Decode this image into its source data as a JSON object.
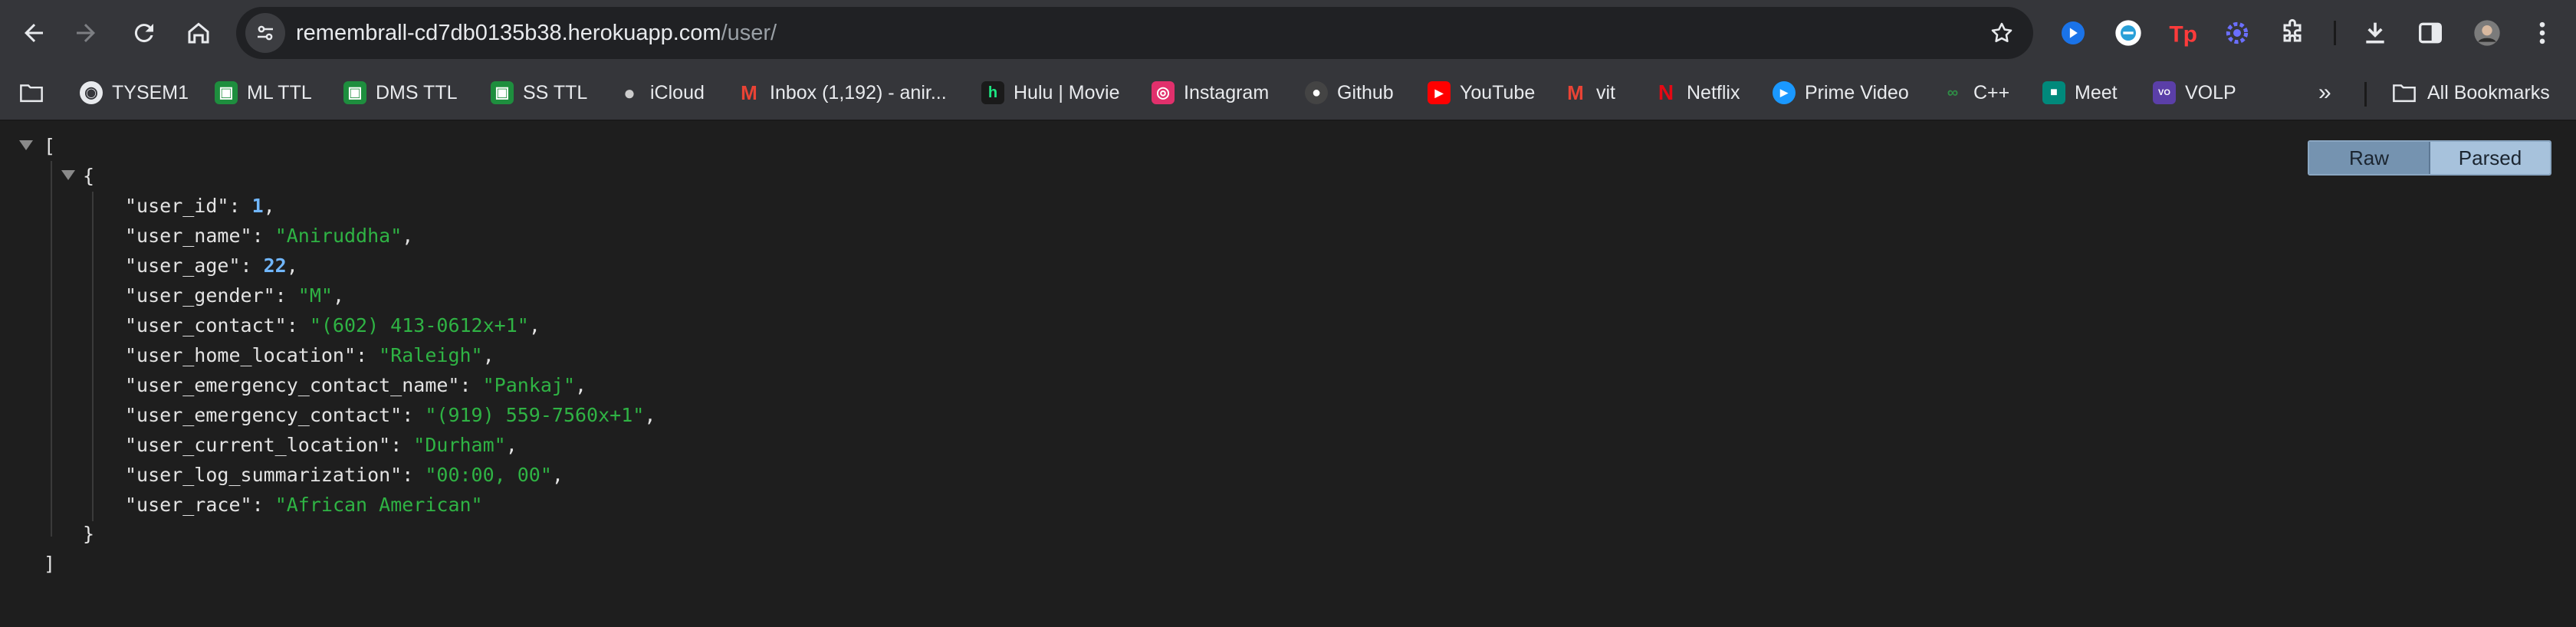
{
  "browser": {
    "url_host": "remembrall-cd7db0135b38.herokuapp.com",
    "url_path": "/user/"
  },
  "bookmarks": [
    {
      "label": "TYSEM1",
      "icon": "chrome-icon",
      "color": "#ffffff"
    },
    {
      "label": "ML TTL",
      "icon": "google-classroom-icon",
      "color": "#f4b400"
    },
    {
      "label": "DMS TTL",
      "icon": "google-classroom-icon",
      "color": "#f4b400"
    },
    {
      "label": "SS TTL",
      "icon": "google-classroom-icon",
      "color": "#f4b400"
    },
    {
      "label": "iCloud",
      "icon": "apple-icon",
      "color": "#cccccc"
    },
    {
      "label": "Inbox (1,192) - anir...",
      "icon": "gmail-icon",
      "color": "#ea4335"
    },
    {
      "label": "Hulu | Movie",
      "icon": "hulu-icon",
      "color": "#1ce783"
    },
    {
      "label": "Instagram",
      "icon": "instagram-icon",
      "color": "#e1306c"
    },
    {
      "label": "Github",
      "icon": "github-icon",
      "color": "#444444"
    },
    {
      "label": "YouTube",
      "icon": "youtube-icon",
      "color": "#ff0000"
    },
    {
      "label": "vit",
      "icon": "gmail-icon",
      "color": "#ea4335"
    },
    {
      "label": "Netflix",
      "icon": "netflix-icon",
      "color": "#e50914"
    },
    {
      "label": "Prime Video",
      "icon": "prime-video-icon",
      "color": "#1a98ff"
    },
    {
      "label": "C++",
      "icon": "geeksforgeeks-icon",
      "color": "#2f8d46"
    },
    {
      "label": "Meet",
      "icon": "google-meet-icon",
      "color": "#00897b"
    },
    {
      "label": "VOLP",
      "icon": "volp-icon",
      "color": "#5b3fa8"
    }
  ],
  "all_bookmarks_label": "All Bookmarks",
  "viewer": {
    "raw_label": "Raw",
    "parsed_label": "Parsed",
    "open_bracket": "[",
    "close_bracket": "]",
    "open_brace": "{",
    "close_brace": "}",
    "fields": [
      {
        "key": "\"user_id\"",
        "value": "1",
        "type": "num"
      },
      {
        "key": "\"user_name\"",
        "value": "\"Aniruddha\"",
        "type": "str"
      },
      {
        "key": "\"user_age\"",
        "value": "22",
        "type": "num"
      },
      {
        "key": "\"user_gender\"",
        "value": "\"M\"",
        "type": "str"
      },
      {
        "key": "\"user_contact\"",
        "value": "\"(602) 413-0612x+1\"",
        "type": "str"
      },
      {
        "key": "\"user_home_location\"",
        "value": "\"Raleigh\"",
        "type": "str"
      },
      {
        "key": "\"user_emergency_contact_name\"",
        "value": "\"Pankaj\"",
        "type": "str"
      },
      {
        "key": "\"user_emergency_contact\"",
        "value": "\"(919) 559-7560x+1\"",
        "type": "str"
      },
      {
        "key": "\"user_current_location\"",
        "value": "\"Durham\"",
        "type": "str"
      },
      {
        "key": "\"user_log_summarization\"",
        "value": "\"00:00, 00\"",
        "type": "str"
      },
      {
        "key": "\"user_race\"",
        "value": "\"African American\"",
        "type": "str"
      }
    ]
  },
  "colors": {
    "toolbar": "#35363a",
    "page": "#1e1e1e",
    "json_number": "#71b7ff",
    "json_string": "#2fb344"
  }
}
